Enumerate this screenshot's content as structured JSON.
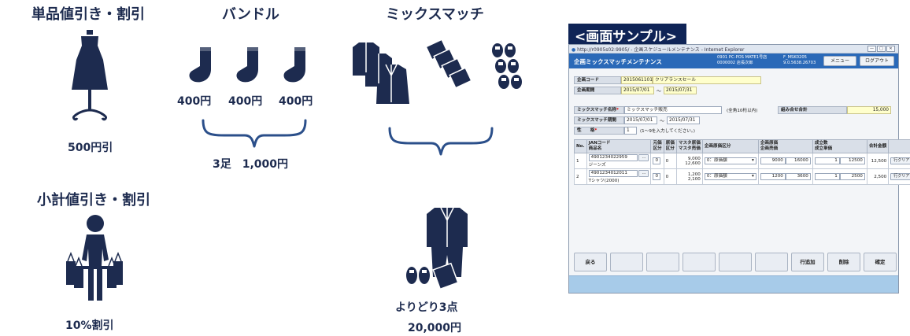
{
  "sections": {
    "single_discount": {
      "title": "単品値引き・割引",
      "caption": "500円引"
    },
    "bundle": {
      "title": "バンドル",
      "prices": [
        "400円",
        "400円",
        "400円"
      ],
      "caption": "3足　1,000円"
    },
    "mix_match": {
      "title": "ミックスマッチ",
      "caption_line1": "よりどり3点",
      "caption_line2": "20,000円"
    },
    "subtotal_discount": {
      "title": "小計値引き・割引",
      "caption": "10%割引"
    }
  },
  "sample_tag": "<画面サンプル>",
  "window": {
    "ie_title": "http://r0905s02:9905/ - 企画スケジュールメンテナンス - Internet Explorer",
    "ie_buttons": [
      "—",
      "□",
      "✕"
    ],
    "app_title": "企画ミックスマッチメンテナンス",
    "info_left_1": "0901 PC-POS MATE1号店",
    "info_left_2": "0000002 店長次郎",
    "info_right_1": "F_MSK0205",
    "info_right_2": "9.0.5638.26703",
    "menu_button": "メニュー",
    "logout_button": "ログアウト",
    "plan_code_label": "企画コード",
    "plan_code_value": "2015061101",
    "plan_name_value": "クリアランスセール",
    "plan_period_label": "企画期間",
    "plan_period_from": "2015/07/01",
    "plan_period_sep": "～",
    "plan_period_to": "2015/07/31",
    "mm_name_label": "ミックスマッチ名称",
    "mm_name_value": "ミックスマッチ販売",
    "mm_name_hint": "(全角10桁以内)",
    "combo_total_label": "組み合せ合計",
    "combo_total_value": "15,000",
    "mm_period_label": "ミックスマッチ期間",
    "mm_period_from": "2015/07/01",
    "mm_period_sep": "～",
    "mm_period_to": "2015/07/31",
    "sex_label": "性　　格",
    "sex_value": "1",
    "sex_hint": "(1～9を入力してください。)",
    "required_mark": "*",
    "table_headers": {
      "no": "No.",
      "jan": "JANコード",
      "name": "商品名",
      "kind1": "元価",
      "kind1b": "区分",
      "kind2": "原価",
      "kind2b": "区分",
      "master1": "マスタ原価",
      "master2": "マスタ売価",
      "price_kind": "企画原価区分",
      "cost": "企画原価",
      "sell": "企画売価",
      "qty": "成立数",
      "unit": "成立単価",
      "total": "合計金額"
    },
    "rows": [
      {
        "no": "1",
        "jan": "4901234022959",
        "name": "ジーンズ",
        "k1": "0",
        "k2": "0",
        "master_cost": "9,000",
        "master_sell": "12,600",
        "price_kind": "0：原価額",
        "plan_cost": "9000",
        "plan_sell": "16000",
        "qty": "1",
        "unit": "12500",
        "total": "12,500",
        "clear": "行クリア",
        "dots": "…"
      },
      {
        "no": "2",
        "jan": "4901234012011",
        "name": "Tシャツ(2000)",
        "k1": "0",
        "k2": "0",
        "master_cost": "1,200",
        "master_sell": "2,100",
        "price_kind": "0：原価額",
        "plan_cost": "1200",
        "plan_sell": "3600",
        "qty": "1",
        "unit": "2500",
        "total": "2,500",
        "clear": "行クリア",
        "dots": "…"
      }
    ],
    "footer_buttons": [
      "戻る",
      "",
      "",
      "",
      "",
      "",
      "",
      "行追加",
      "削除",
      "確定"
    ]
  },
  "icons": [
    "dress-on-mannequin-icon",
    "sock-icon",
    "sock-icon",
    "sock-icon",
    "brace-icon",
    "suit-jackets-icon",
    "shirts-icon",
    "shoes-icon",
    "brace-icon",
    "suit-icon",
    "shoes-icon",
    "shirt-icon",
    "woman-shopping-icon"
  ],
  "colors": {
    "navy": "#1d2b4f",
    "accent_blue": "#2b4f8a",
    "app_header": "#2a69b8",
    "readonly_yellow": "#ffffcc",
    "status_bar": "#a7cbe9"
  }
}
